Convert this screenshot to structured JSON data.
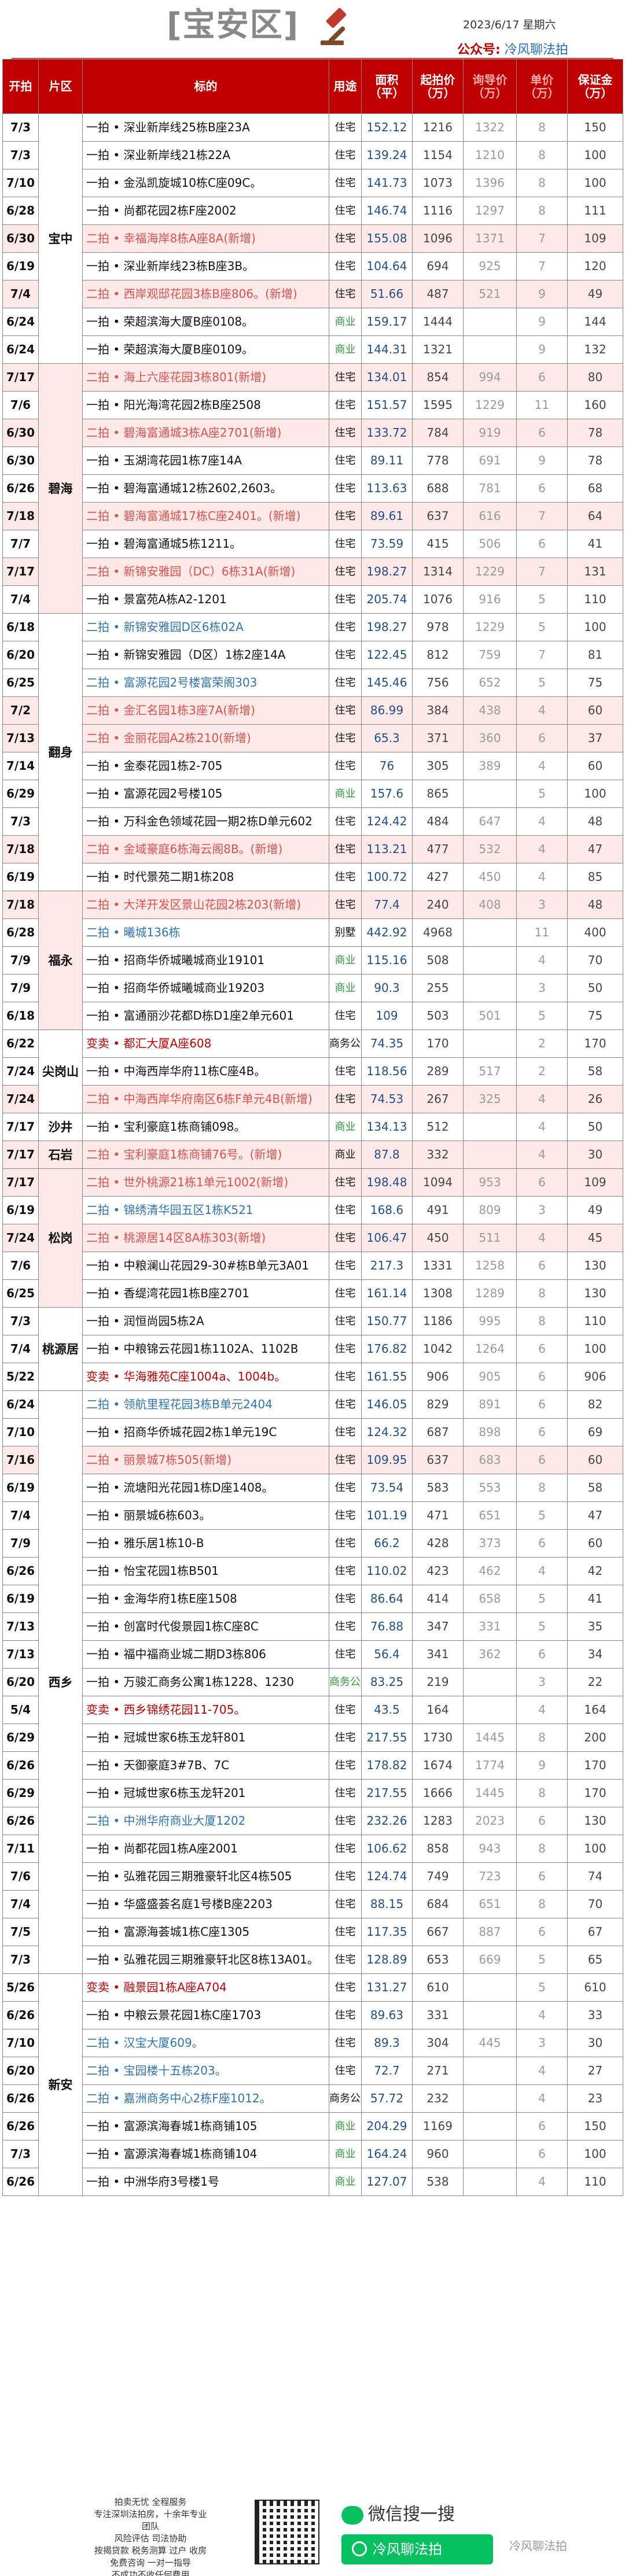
{
  "header": {
    "district": "[宝安区]",
    "date": "2023/6/17  星期六",
    "gzh_label": "公众号:",
    "gzh_value": "冷风聊法拍",
    "gavel_icon": "gavel-icon"
  },
  "columns": [
    "开拍",
    "片区",
    "标的",
    "用途",
    "面积（平）",
    "起拍价（万）",
    "询导价（万）",
    "单价（万）",
    "保证金（万）"
  ],
  "areas": [
    {
      "name": "宝中",
      "rows": 9
    },
    {
      "name": "碧海",
      "rows": 9
    },
    {
      "name": "翻身",
      "rows": 10
    },
    {
      "name": "福永",
      "rows": 5
    },
    {
      "name": "尖岗山",
      "rows": 3
    },
    {
      "name": "沙井",
      "rows": 1
    },
    {
      "name": "石岩",
      "rows": 1
    },
    {
      "name": "松岗",
      "rows": 5
    },
    {
      "name": "桃源居",
      "rows": 3
    },
    {
      "name": "西乡",
      "rows": 21
    },
    {
      "name": "新安",
      "rows": 19
    }
  ],
  "rows": [
    [
      "7/3",
      "一拍 • 深业新岸线25栋B座23A",
      "住宅",
      "152.12",
      "1216",
      "1322",
      "8",
      "150",
      ""
    ],
    [
      "7/3",
      "一拍 • 深业新岸线21栋22A",
      "住宅",
      "139.24",
      "1154",
      "1210",
      "8",
      "100",
      ""
    ],
    [
      "7/10",
      "一拍 • 金泓凯旋城10栋C座09C。",
      "住宅",
      "141.73",
      "1073",
      "1396",
      "8",
      "100",
      ""
    ],
    [
      "6/28",
      "一拍 • 尚都花园2栋F座2002",
      "住宅",
      "146.74",
      "1116",
      "1297",
      "8",
      "111",
      ""
    ],
    [
      "6/30",
      "二拍 • 幸福海岸8栋A座8A(新增)",
      "住宅",
      "155.08",
      "1096",
      "1371",
      "7",
      "109",
      "pink"
    ],
    [
      "6/19",
      "一拍 • 深业新岸线23栋B座3B。",
      "住宅",
      "104.64",
      "694",
      "925",
      "7",
      "120",
      ""
    ],
    [
      "7/4",
      "二拍 • 西岸观邸花园3栋B座806。(新增)",
      "住宅",
      "51.66",
      "487",
      "521",
      "9",
      "49",
      "pink"
    ],
    [
      "6/24",
      "一拍 • 荣超滨海大厦B座0108。",
      "商业",
      "159.17",
      "1444",
      "",
      "9",
      "144",
      "g"
    ],
    [
      "6/24",
      "一拍 • 荣超滨海大厦B座0109。",
      "商业",
      "144.31",
      "1321",
      "",
      "9",
      "132",
      "g"
    ],
    [
      "7/17",
      "二拍 • 海上六座花园3栋801(新增)",
      "住宅",
      "134.01",
      "854",
      "994",
      "6",
      "80",
      "pink"
    ],
    [
      "7/6",
      "一拍 • 阳光海湾花园2栋B座2508",
      "住宅",
      "151.57",
      "1595",
      "1229",
      "11",
      "160",
      ""
    ],
    [
      "6/30",
      "二拍 • 碧海富通城3栋A座2701(新增)",
      "住宅",
      "133.72",
      "784",
      "919",
      "6",
      "78",
      "pink"
    ],
    [
      "6/30",
      "一拍 • 玉湖湾花园1栋7座14A",
      "住宅",
      "89.11",
      "778",
      "691",
      "9",
      "78",
      ""
    ],
    [
      "6/26",
      "一拍 • 碧海富通城12栋2602,2603。",
      "住宅",
      "113.63",
      "688",
      "781",
      "6",
      "68",
      ""
    ],
    [
      "7/18",
      "二拍 • 碧海富通城17栋C座2401。(新增)",
      "住宅",
      "89.61",
      "637",
      "616",
      "7",
      "64",
      "pink"
    ],
    [
      "7/7",
      "一拍 • 碧海富通城5栋1211。",
      "住宅",
      "73.59",
      "415",
      "506",
      "6",
      "41",
      ""
    ],
    [
      "",
      "",
      "",
      "",
      "",
      "",
      "",
      "",
      ""
    ],
    [
      "",
      "",
      "",
      "",
      "",
      "",
      "",
      "",
      ""
    ],
    [
      "7/17",
      "二拍 • 新锦安雅园（DC）6栋31A(新增)",
      "住宅",
      "198.27",
      "1314",
      "1229",
      "7",
      "131",
      "pink"
    ],
    [
      "7/4",
      "一拍 • 景富苑A栋A2-1201",
      "住宅",
      "205.74",
      "1076",
      "916",
      "5",
      "110",
      ""
    ],
    [
      "6/18",
      "二拍 • 新锦安雅园D区6栋02A",
      "住宅",
      "198.27",
      "978",
      "1229",
      "5",
      "100",
      "blue"
    ],
    [
      "6/20",
      "一拍 • 新锦安雅园（D区）1栋2座14A",
      "住宅",
      "122.45",
      "812",
      "759",
      "7",
      "81",
      ""
    ],
    [
      "6/25",
      "二拍 • 富源花园2号楼富荣阁303",
      "住宅",
      "145.46",
      "756",
      "652",
      "5",
      "75",
      "blue"
    ],
    [
      "7/2",
      "二拍 • 金汇名园1栋3座7A(新增)",
      "住宅",
      "86.99",
      "384",
      "438",
      "4",
      "60",
      "pink"
    ],
    [
      "7/13",
      "二拍 • 金丽花园A2栋210(新增)",
      "住宅",
      "65.3",
      "371",
      "360",
      "6",
      "37",
      "pink"
    ],
    [
      "7/14",
      "一拍 • 金泰花园1栋2-705",
      "住宅",
      "76",
      "305",
      "389",
      "4",
      "60",
      ""
    ],
    [
      "6/29",
      "一拍 • 富源花园2号楼105",
      "商业",
      "157.6",
      "865",
      "",
      "5",
      "100",
      "g"
    ],
    [
      "",
      "",
      "",
      "",
      "",
      "",
      "",
      "",
      ""
    ],
    [
      "7/3",
      "一拍 • 万科金色领域花园一期2栋D单元602",
      "住宅",
      "124.42",
      "484",
      "647",
      "4",
      "48",
      ""
    ],
    [
      "7/18",
      "二拍 • 金域豪庭6栋海云阁8B。(新增)",
      "住宅",
      "113.21",
      "477",
      "532",
      "4",
      "47",
      "pink"
    ],
    [
      "6/19",
      "一拍 • 时代景苑二期1栋208",
      "住宅",
      "100.72",
      "427",
      "450",
      "4",
      "85",
      ""
    ],
    [
      "7/18",
      "二拍 • 大洋开发区景山花园2栋203(新增)",
      "住宅",
      "77.4",
      "240",
      "408",
      "3",
      "48",
      "pink"
    ],
    [
      "",
      "",
      "",
      "",
      "",
      "",
      "",
      "",
      ""
    ],
    [
      "6/28",
      "二拍 • 曦城136栋",
      "别墅",
      "442.92",
      "4968",
      "",
      "11",
      "400",
      "blue"
    ],
    [
      "7/9",
      "一拍 • 招商华侨城曦城商业19101",
      "商业",
      "115.16",
      "508",
      "",
      "4",
      "70",
      "g"
    ],
    [
      "7/9",
      "一拍 • 招商华侨城曦城商业19203",
      "商业",
      "90.3",
      "255",
      "",
      "3",
      "50",
      "g"
    ],
    [
      "6/18",
      "一拍 • 富通丽沙花都D栋D1座2单元601",
      "住宅",
      "109",
      "503",
      "501",
      "5",
      "75",
      ""
    ],
    [
      "6/22",
      "变卖 • 都汇大厦A座608",
      "商务公寓",
      "74.35",
      "170",
      "",
      "2",
      "170",
      "dred"
    ],
    [
      "7/24",
      "一拍 • 中海西岸华府11栋C座4B。",
      "住宅",
      "118.56",
      "289",
      "517",
      "2",
      "58",
      ""
    ],
    [
      "7/24",
      "二拍 • 中海西岸华府南区6栋F单元4B(新增)",
      "住宅",
      "74.53",
      "267",
      "325",
      "4",
      "26",
      "pink"
    ],
    [
      "7/17",
      "一拍 • 宝利豪庭1栋商铺098。",
      "商业",
      "134.13",
      "512",
      "",
      "4",
      "50",
      "g"
    ],
    [
      "7/17",
      "二拍 • 宝利豪庭1栋商铺76号。(新增)",
      "商业",
      "87.8",
      "332",
      "",
      "4",
      "30",
      "pink"
    ],
    [
      "",
      "",
      "",
      "",
      "",
      "",
      "",
      "",
      ""
    ],
    [
      "7/17",
      "二拍 • 世外桃源21栋1单元1002(新增)",
      "住宅",
      "198.48",
      "1094",
      "953",
      "6",
      "109",
      "pink"
    ],
    [
      "6/19",
      "二拍 • 锦绣清华园五区1栋K521",
      "住宅",
      "168.6",
      "491",
      "809",
      "3",
      "49",
      "blue"
    ],
    [
      "7/24",
      "二拍 • 桃源居14区8A栋303(新增)",
      "住宅",
      "106.47",
      "450",
      "511",
      "4",
      "45",
      "pink"
    ],
    [
      "7/6",
      "一拍 • 中粮澜山花园29-30#栋B单元3A01",
      "住宅",
      "217.3",
      "1331",
      "1258",
      "6",
      "130",
      ""
    ],
    [
      "6/25",
      "一拍 • 香缇湾花园1栋B座2701",
      "住宅",
      "161.14",
      "1308",
      "1289",
      "8",
      "130",
      ""
    ],
    [
      "7/3",
      "一拍 • 润恒尚园5栋2A",
      "住宅",
      "150.77",
      "1186",
      "995",
      "8",
      "110",
      ""
    ],
    [
      "7/4",
      "一拍 • 中粮锦云花园1栋1102A、1102B",
      "住宅",
      "176.82",
      "1042",
      "1264",
      "6",
      "100",
      ""
    ],
    [
      "5/22",
      "变卖 • 华海雅苑C座1004a、1004b。",
      "住宅",
      "161.55",
      "906",
      "905",
      "6",
      "906",
      "dred"
    ],
    [
      "6/24",
      "二拍 • 领航里程花园3栋B单元2404",
      "住宅",
      "146.05",
      "829",
      "891",
      "6",
      "82",
      "blue"
    ],
    [
      "7/10",
      "一拍 • 招商华侨城花园2栋1单元19C",
      "住宅",
      "124.32",
      "687",
      "898",
      "6",
      "69",
      ""
    ],
    [
      "7/16",
      "二拍 • 丽景城7栋505(新增)",
      "住宅",
      "109.95",
      "637",
      "683",
      "6",
      "60",
      "pink"
    ],
    [
      "6/19",
      "一拍 • 流塘阳光花园1栋D座1408。",
      "住宅",
      "73.54",
      "583",
      "553",
      "8",
      "58",
      ""
    ],
    [
      "7/4",
      "一拍 • 丽景城6栋603。",
      "住宅",
      "101.19",
      "471",
      "651",
      "5",
      "47",
      ""
    ],
    [
      "7/9",
      "一拍 • 雅乐居1栋10-B",
      "住宅",
      "66.2",
      "428",
      "373",
      "6",
      "60",
      ""
    ],
    [
      "6/26",
      "一拍 • 怡宝花园1栋B501",
      "住宅",
      "110.02",
      "423",
      "462",
      "4",
      "42",
      ""
    ],
    [
      "6/19",
      "一拍 • 金海华府1栋E座1508",
      "住宅",
      "86.64",
      "414",
      "658",
      "5",
      "41",
      ""
    ],
    [
      "7/13",
      "一拍 • 创富时代俊景园1栋C座8C",
      "住宅",
      "76.88",
      "347",
      "331",
      "5",
      "35",
      ""
    ],
    [
      "7/13",
      "一拍 • 福中福商业城二期D3栋806",
      "住宅",
      "56.4",
      "341",
      "362",
      "6",
      "34",
      ""
    ],
    [
      "6/20",
      "一拍 • 万骏汇商务公寓1栋1228、1230",
      "商务公寓",
      "83.25",
      "219",
      "",
      "3",
      "22",
      "g"
    ],
    [
      "5/4",
      "变卖 • 西乡锦绣花园11-705。",
      "住宅",
      "43.5",
      "164",
      "",
      "4",
      "164",
      "dred"
    ],
    [
      "6/29",
      "一拍 • 冠城世家6栋玉龙轩801",
      "住宅",
      "217.55",
      "1730",
      "1445",
      "8",
      "200",
      ""
    ],
    [
      "6/26",
      "一拍 • 天御豪庭3#7B、7C",
      "住宅",
      "178.82",
      "1674",
      "1774",
      "9",
      "170",
      ""
    ],
    [
      "6/29",
      "一拍 • 冠城世家6栋玉龙轩201",
      "住宅",
      "217.55",
      "1666",
      "1445",
      "8",
      "170",
      ""
    ],
    [
      "6/26",
      "二拍 • 中洲华府商业大厦1202",
      "住宅",
      "232.26",
      "1283",
      "2023",
      "6",
      "130",
      "blue"
    ],
    [
      "7/11",
      "一拍 • 尚都花园1栋A座2001",
      "住宅",
      "106.62",
      "858",
      "943",
      "8",
      "100",
      ""
    ],
    [
      "7/6",
      "一拍 • 弘雅花园三期雅豪轩北区4栋505",
      "住宅",
      "124.74",
      "749",
      "723",
      "6",
      "74",
      ""
    ],
    [
      "7/4",
      "一拍 • 华盛盛荟名庭1号楼B座2203",
      "住宅",
      "88.15",
      "684",
      "651",
      "8",
      "70",
      ""
    ],
    [
      "7/5",
      "一拍 • 富源海荟城1栋C座1305",
      "住宅",
      "117.35",
      "667",
      "887",
      "6",
      "67",
      ""
    ],
    [
      "7/3",
      "一拍 • 弘雅花园三期雅豪轩北区8栋13A01。",
      "住宅",
      "128.89",
      "653",
      "669",
      "5",
      "65",
      ""
    ],
    [
      "5/26",
      "变卖 • 融景园1栋A座A704",
      "住宅",
      "131.27",
      "610",
      "",
      "5",
      "610",
      "dred"
    ],
    [
      "6/26",
      "一拍 • 中粮云景花园1栋C座1703",
      "住宅",
      "89.63",
      "331",
      "",
      "4",
      "33",
      ""
    ],
    [
      "7/10",
      "二拍 • 汉宝大厦609。",
      "住宅",
      "89.3",
      "304",
      "445",
      "3",
      "30",
      "blue"
    ],
    [
      "6/20",
      "二拍 • 宝园楼十五栋203。",
      "住宅",
      "72.7",
      "271",
      "",
      "4",
      "27",
      "blue"
    ],
    [
      "6/26",
      "二拍 • 嘉洲商务中心2栋F座1012。",
      "商务公寓",
      "57.72",
      "232",
      "",
      "4",
      "23",
      "blue"
    ],
    [
      "6/26",
      "一拍 • 富源滨海春城1栋商铺105",
      "商业",
      "204.29",
      "1169",
      "",
      "6",
      "150",
      "g"
    ],
    [
      "7/3",
      "一拍 • 富源滨海春城1栋商铺104",
      "商业",
      "164.24",
      "960",
      "",
      "6",
      "100",
      "g"
    ],
    [
      "6/26",
      "一拍 • 中洲华府3号楼1号",
      "商业",
      "127.07",
      "538",
      "",
      "4",
      "110",
      "g"
    ]
  ],
  "footer": {
    "text": [
      "拍卖无忧 全程服务",
      "专注深圳法拍房，十余年专业团队",
      "风险评估 司法协助",
      "按揭贷款 税务测算 过户 收房",
      "免费咨询 一对一指导",
      "不成功不收任何费用"
    ],
    "qr_icon": "qr-code-icon",
    "wx_search": "微信搜一搜",
    "wx_button": "冷风聊法拍",
    "brand": "冷风聊法拍"
  }
}
